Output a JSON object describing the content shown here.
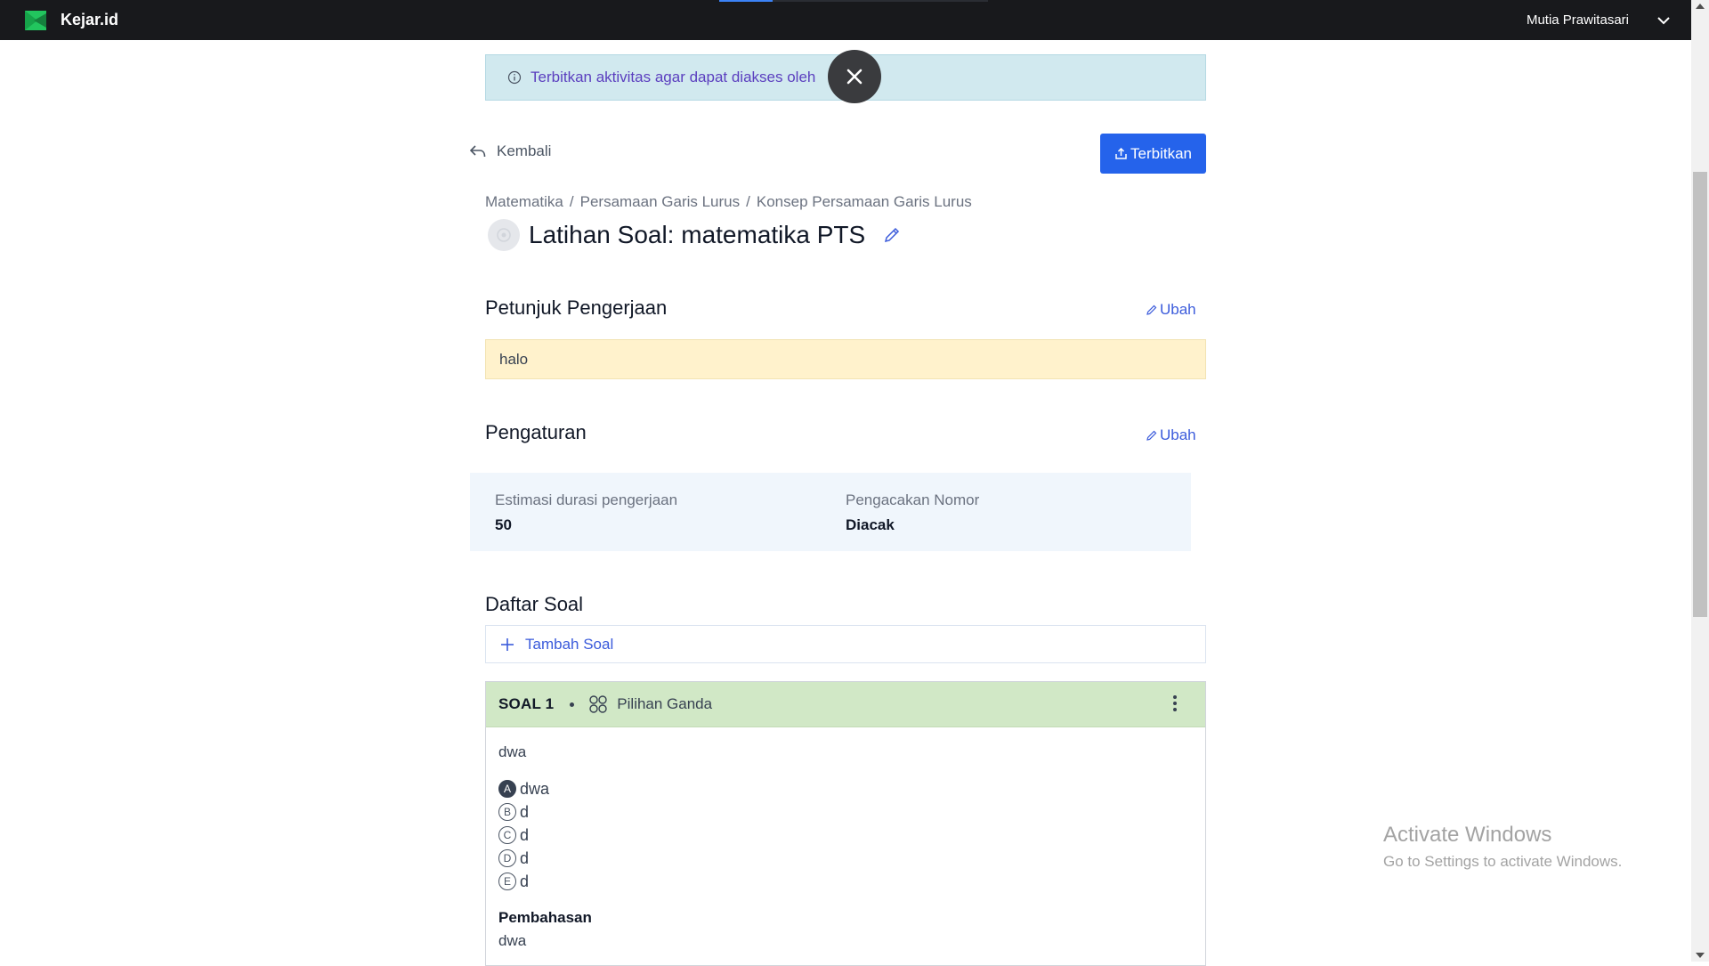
{
  "app": {
    "brand": "Kejar.id",
    "user_name": "Mutia Prawitasari"
  },
  "notice": {
    "text": "Terbitkan aktivitas agar dapat diakses oleh"
  },
  "actions": {
    "back_label": "Kembali",
    "publish_label": "Terbitkan"
  },
  "breadcrumb": [
    "Matematika",
    "Persamaan Garis Lurus",
    "Konsep Persamaan Garis Lurus"
  ],
  "page": {
    "title": "Latihan Soal: matematika PTS"
  },
  "instructions": {
    "heading": "Petunjuk Pengerjaan",
    "edit_label": "Ubah",
    "text": "halo"
  },
  "settings": {
    "heading": "Pengaturan",
    "edit_label": "Ubah",
    "items": [
      {
        "label": "Estimasi durasi pengerjaan",
        "value": "50"
      },
      {
        "label": "Pengacakan Nomor",
        "value": "Diacak"
      }
    ]
  },
  "questions_section": {
    "heading": "Daftar Soal",
    "add_label": "Tambah Soal"
  },
  "question": {
    "number_label": "SOAL 1",
    "type": "Pilihan Ganda",
    "text": "dwa",
    "options": [
      {
        "letter": "A",
        "text": "dwa",
        "correct": true
      },
      {
        "letter": "B",
        "text": "d",
        "correct": false
      },
      {
        "letter": "C",
        "text": "d",
        "correct": false
      },
      {
        "letter": "D",
        "text": "d",
        "correct": false
      },
      {
        "letter": "E",
        "text": "d",
        "correct": false
      }
    ],
    "explanation_heading": "Pembahasan",
    "explanation_text": "dwa"
  },
  "watermark": {
    "title": "Activate Windows",
    "subtitle": "Go to Settings to activate Windows."
  },
  "colors": {
    "topbar": "#18191c",
    "primary": "#2563eb",
    "notice_bg": "#d1e9ef",
    "question_header": "#d1e8c6",
    "instruction_bg": "#fff2cc"
  }
}
